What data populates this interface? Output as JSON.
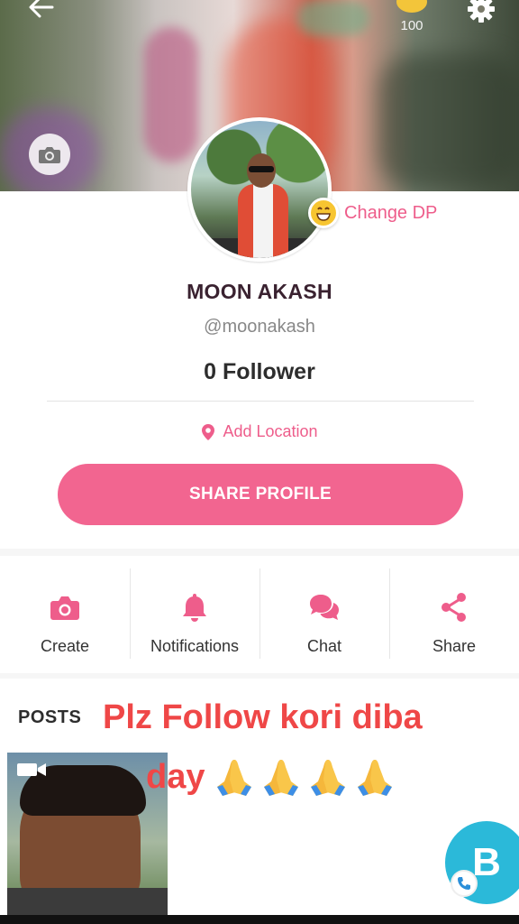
{
  "header": {
    "back_icon": "arrow-left-icon",
    "coin_icon": "coin-icon",
    "coin_count": "100",
    "settings_icon": "gear-icon",
    "cover_camera_icon": "camera-icon"
  },
  "profile": {
    "change_dp_label": "Change DP",
    "change_dp_icon": "smiley-icon",
    "name": "MOON AKASH",
    "handle": "@moonakash",
    "followers": "0 Follower",
    "location_label": "Add Location",
    "location_icon": "pin-icon",
    "share_profile_label": "SHARE PROFILE"
  },
  "actions": [
    {
      "label": "Create",
      "icon": "camera-icon"
    },
    {
      "label": "Notifications",
      "icon": "bell-icon"
    },
    {
      "label": "Chat",
      "icon": "chat-bubbles-icon"
    },
    {
      "label": "Share",
      "icon": "share-icon"
    }
  ],
  "posts": {
    "title": "POSTS",
    "overlay_line1": "Plz Follow kori diba",
    "overlay_line2": "day",
    "video_badge_icon": "video-icon"
  },
  "fab": {
    "letter": "B",
    "call_icon": "phone-icon"
  },
  "colors": {
    "accent": "#f26590",
    "pink_text": "#ee5d8b",
    "overlay_red": "#ef4747",
    "fab": "#2bb9d9"
  }
}
